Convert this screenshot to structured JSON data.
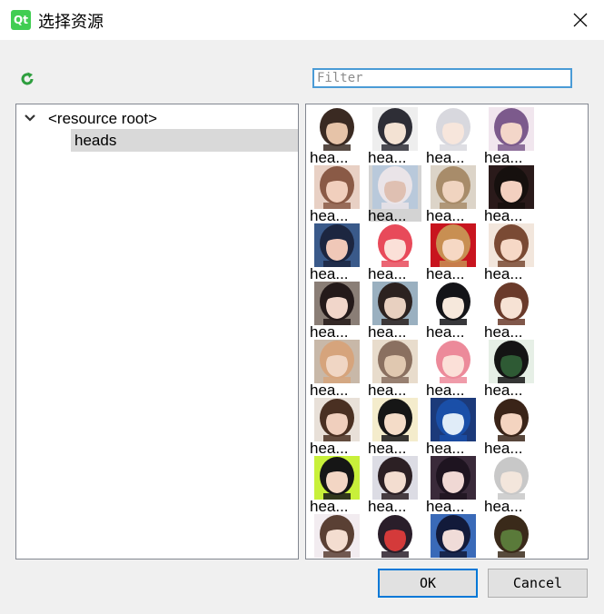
{
  "window": {
    "title": "选择资源",
    "logo_text": "Qt",
    "close_icon": "close-icon",
    "refresh_icon": "refresh-icon"
  },
  "filter": {
    "placeholder": "Filter",
    "value": ""
  },
  "tree": {
    "root_label": "<resource root>",
    "child_label": "heads",
    "child_selected": true
  },
  "colors": {
    "accent": "#0078d7",
    "filter_border": "#4a9bd6",
    "selection": "#d9d9d9",
    "refresh": "#2e9e3e",
    "qt_green": "#41cd52"
  },
  "grid": {
    "columns": 4,
    "selected_index": 5,
    "items": [
      {
        "label": "hea...",
        "palette": [
          "#ffffff",
          "#3a2a22",
          "#e6c3a8"
        ]
      },
      {
        "label": "hea...",
        "palette": [
          "#eeeeee",
          "#2e2e36",
          "#f3e2d3"
        ]
      },
      {
        "label": "hea...",
        "palette": [
          "#ffffff",
          "#d8d8de",
          "#f7e6dc"
        ]
      },
      {
        "label": "hea...",
        "palette": [
          "#f1e6ee",
          "#7c5a8c",
          "#f3d6c9"
        ]
      },
      {
        "label": "hea...",
        "palette": [
          "#e8d0c4",
          "#8a5a46",
          "#f1cfbd"
        ]
      },
      {
        "label": "hea...",
        "palette": [
          "#b9c9db",
          "#eae4e8",
          "#dfc0b2"
        ]
      },
      {
        "label": "hea...",
        "palette": [
          "#dcd4c8",
          "#a88c6a",
          "#f0d4c0"
        ]
      },
      {
        "label": "hea...",
        "palette": [
          "#2a1a1a",
          "#16100e",
          "#f3d0c0"
        ]
      },
      {
        "label": "hea...",
        "palette": [
          "#3a5a8a",
          "#1c2640",
          "#f0c8b8"
        ]
      },
      {
        "label": "hea...",
        "palette": [
          "#ffffff",
          "#e84a5a",
          "#fbe0d8"
        ]
      },
      {
        "label": "hea...",
        "palette": [
          "#c8141e",
          "#c88f52",
          "#f6d8c4"
        ]
      },
      {
        "label": "hea...",
        "palette": [
          "#f2e6dc",
          "#7a4a34",
          "#f6d8c6"
        ]
      },
      {
        "label": "hea...",
        "palette": [
          "#8a7e76",
          "#241a1a",
          "#f1d6ca"
        ]
      },
      {
        "label": "hea...",
        "palette": [
          "#9ab0c0",
          "#2c2220",
          "#e8d0c0"
        ]
      },
      {
        "label": "hea...",
        "palette": [
          "#ffffff",
          "#141418",
          "#f6e8dc"
        ]
      },
      {
        "label": "hea...",
        "palette": [
          "#ffffff",
          "#6a3a2a",
          "#f6e2d4"
        ]
      },
      {
        "label": "hea...",
        "palette": [
          "#c8b8a8",
          "#d6a47c",
          "#f0d6c4"
        ]
      },
      {
        "label": "hea...",
        "palette": [
          "#e8dccc",
          "#8a7060",
          "#e0c8b0"
        ]
      },
      {
        "label": "hea...",
        "palette": [
          "#ffffff",
          "#ec8a9a",
          "#fbe0d8"
        ]
      },
      {
        "label": "hea...",
        "palette": [
          "#e6efe6",
          "#141414",
          "#2e5a34"
        ]
      },
      {
        "label": "hea...",
        "palette": [
          "#e8e0d8",
          "#4a3022",
          "#f0cfbd"
        ]
      },
      {
        "label": "hea...",
        "palette": [
          "#f4eccc",
          "#161616",
          "#f4dcc8"
        ]
      },
      {
        "label": "hea...",
        "palette": [
          "#1c3a7a",
          "#1a4fa8",
          "#e0ecf8"
        ]
      },
      {
        "label": "hea...",
        "palette": [
          "#ffffff",
          "#3a2418",
          "#f4d4c0"
        ]
      },
      {
        "label": "hea...",
        "palette": [
          "#c8f03a",
          "#161616",
          "#f3d6c4"
        ]
      },
      {
        "label": "hea...",
        "palette": [
          "#dcdce4",
          "#2c2024",
          "#f3ddd0"
        ]
      },
      {
        "label": "hea...",
        "palette": [
          "#3a2a3a",
          "#1e1420",
          "#f0d8d4"
        ]
      },
      {
        "label": "hea...",
        "palette": [
          "#ffffff",
          "#c8c8c8",
          "#f3e6dc"
        ]
      },
      {
        "label": "",
        "palette": [
          "#f2ecf0",
          "#5a4034",
          "#f3ddd0"
        ]
      },
      {
        "label": "",
        "palette": [
          "#ffffff",
          "#2a1e2a",
          "#d43a3a"
        ]
      },
      {
        "label": "",
        "palette": [
          "#3a6ab8",
          "#121a3a",
          "#f0dcd8"
        ]
      },
      {
        "label": "",
        "palette": [
          "#ffffff",
          "#3a2a1a",
          "#5a7a3a"
        ]
      }
    ]
  },
  "buttons": {
    "ok": "OK",
    "cancel": "Cancel"
  }
}
